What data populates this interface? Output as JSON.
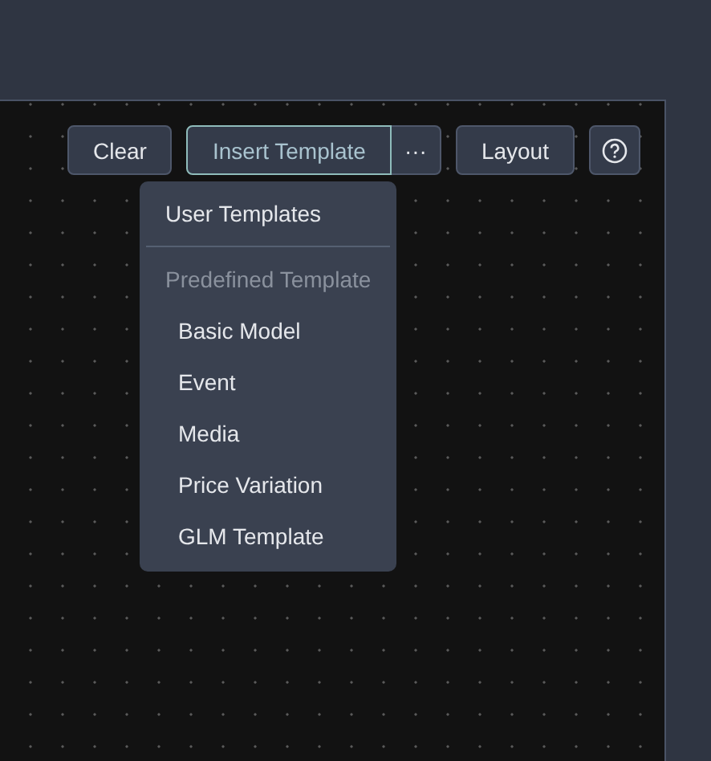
{
  "toolbar": {
    "buttons": [
      {
        "kind": "text",
        "label": "Clear",
        "selected": false
      },
      {
        "kind": "split",
        "label": "Insert Template",
        "more": "···",
        "selected": true
      },
      {
        "kind": "text",
        "label": "Layout",
        "selected": false
      },
      {
        "kind": "help",
        "selected": false
      }
    ]
  },
  "dropdown": {
    "items": [
      {
        "kind": "item",
        "label": "User Templates"
      },
      {
        "kind": "divider"
      },
      {
        "kind": "header",
        "label": "Predefined Template"
      },
      {
        "kind": "subitem",
        "label": "Basic Model"
      },
      {
        "kind": "subitem",
        "label": "Event"
      },
      {
        "kind": "subitem",
        "label": "Media"
      },
      {
        "kind": "subitem",
        "label": "Price Variation"
      },
      {
        "kind": "subitem",
        "label": "GLM Template"
      }
    ]
  }
}
